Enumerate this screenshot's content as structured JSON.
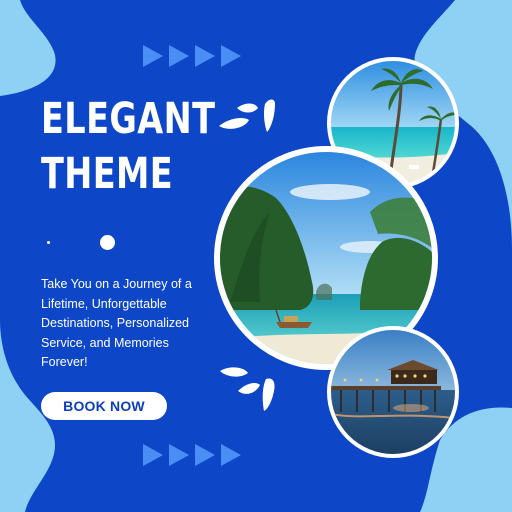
{
  "title": {
    "line1": "ELEGANT",
    "line2": "THEME"
  },
  "description": "Take You on a Journey of a Lifetime, Unforgettable Destinations, Personalized Service, and Memories Forever!",
  "cta": {
    "label": "BOOK NOW"
  },
  "colors": {
    "background_light": "#8fd0f5",
    "background_dark": "#0d47c8",
    "arrow": "#4a8ef5",
    "text": "#ffffff",
    "button_text": "#0b3fb8"
  },
  "photos": [
    {
      "subject": "beach with palm trees"
    },
    {
      "subject": "tropical bay with longtail boat and limestone cliffs"
    },
    {
      "subject": "overwater restaurant pier at dusk"
    }
  ],
  "icons": [
    "arrow-right-icon",
    "splash-icon",
    "dot-icon"
  ]
}
